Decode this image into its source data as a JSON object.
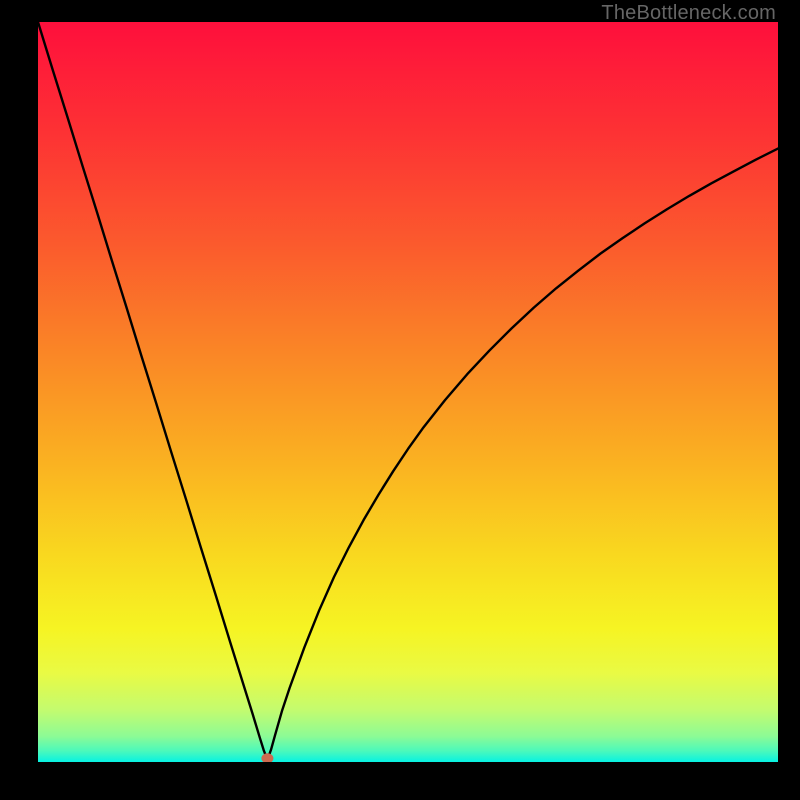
{
  "watermark": "TheBottleneck.com",
  "colors": {
    "frame_bg": "#000000",
    "curve": "#000000",
    "marker_fill": "#cc6a50",
    "gradient_stops": [
      {
        "offset": 0.0,
        "color": "#fe0f3c"
      },
      {
        "offset": 0.15,
        "color": "#fd3234"
      },
      {
        "offset": 0.3,
        "color": "#fb5a2d"
      },
      {
        "offset": 0.45,
        "color": "#fa8726"
      },
      {
        "offset": 0.6,
        "color": "#fab321"
      },
      {
        "offset": 0.72,
        "color": "#f9d81f"
      },
      {
        "offset": 0.82,
        "color": "#f6f423"
      },
      {
        "offset": 0.88,
        "color": "#e9fa44"
      },
      {
        "offset": 0.93,
        "color": "#c3fb6f"
      },
      {
        "offset": 0.965,
        "color": "#8dfb95"
      },
      {
        "offset": 0.985,
        "color": "#4cf9bb"
      },
      {
        "offset": 1.0,
        "color": "#07f2e3"
      }
    ]
  },
  "chart_data": {
    "type": "line",
    "title": "",
    "xlabel": "",
    "ylabel": "",
    "xlim": [
      0,
      100
    ],
    "ylim": [
      0,
      100
    ],
    "annotations": [],
    "marker": {
      "x": 31,
      "y": 0.5
    },
    "series": [
      {
        "name": "curve",
        "x": [
          0,
          2,
          4,
          6,
          8,
          10,
          12,
          14,
          16,
          18,
          20,
          22,
          24,
          26,
          28,
          29,
          30,
          30.5,
          31,
          31.5,
          32,
          33,
          34,
          36,
          38,
          40,
          42,
          44,
          46,
          48,
          50,
          52,
          55,
          58,
          61,
          64,
          67,
          70,
          73,
          76,
          79,
          82,
          85,
          88,
          91,
          94,
          97,
          100
        ],
        "y": [
          100,
          93.5,
          87.1,
          80.6,
          74.2,
          67.7,
          61.3,
          54.8,
          48.4,
          41.9,
          35.5,
          29.0,
          22.6,
          16.1,
          9.7,
          6.5,
          3.2,
          1.6,
          0.3,
          1.7,
          3.5,
          7.0,
          10.0,
          15.5,
          20.5,
          25.0,
          29.0,
          32.7,
          36.1,
          39.3,
          42.3,
          45.1,
          48.9,
          52.4,
          55.6,
          58.6,
          61.4,
          64.0,
          66.4,
          68.7,
          70.8,
          72.8,
          74.7,
          76.5,
          78.2,
          79.8,
          81.4,
          82.9
        ]
      }
    ]
  }
}
